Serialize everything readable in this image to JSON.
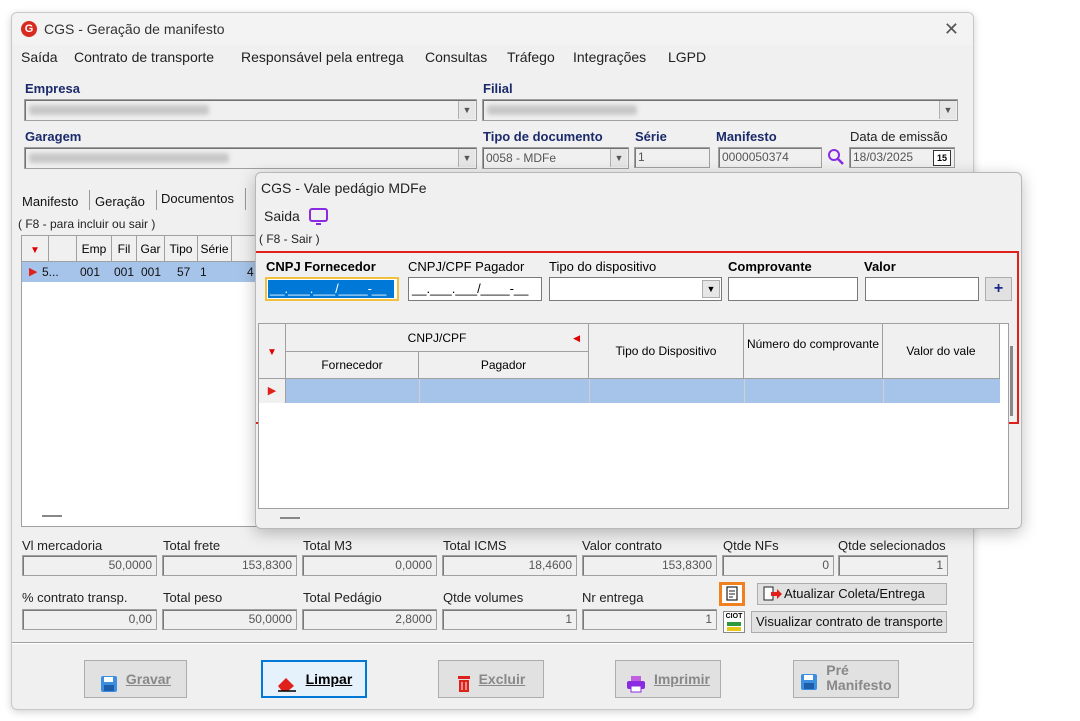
{
  "window": {
    "title": "CGS - Geração de manifesto",
    "logo_letter": "G"
  },
  "menu": [
    "Saída",
    "Contrato de transporte",
    "Responsável pela entrega",
    "Consultas",
    "Tráfego",
    "Integrações",
    "LGPD"
  ],
  "header": {
    "empresa_label": "Empresa",
    "filial_label": "Filial",
    "garagem_label": "Garagem",
    "tipo_documento_label": "Tipo de documento",
    "tipo_documento_value": "0058 - MDFe",
    "serie_label": "Série",
    "serie_value": "1",
    "manifesto_label": "Manifesto",
    "manifesto_value": "0000050374",
    "data_emissao_label": "Data de emissão",
    "data_emissao_value": "18/03/2025",
    "calendar_label": "15"
  },
  "tabs": [
    "Manifesto",
    "Geração",
    "Documentos"
  ],
  "tab_hint": "( F8 - para incluir ou sair )",
  "doc_grid": {
    "columns": [
      "Emp",
      "Fil",
      "Gar",
      "Tipo",
      "Série"
    ],
    "row": [
      "5...",
      "001",
      "001",
      "001",
      "57",
      "1",
      "4"
    ]
  },
  "totals": {
    "vl_mercadoria": {
      "label": "Vl mercadoria",
      "value": "50,0000"
    },
    "total_frete": {
      "label": "Total frete",
      "value": "153,8300"
    },
    "total_m3": {
      "label": "Total M3",
      "value": "0,0000"
    },
    "total_icms": {
      "label": "Total ICMS",
      "value": "18,4600"
    },
    "valor_contrato": {
      "label": "Valor contrato",
      "value": "153,8300"
    },
    "qtde_nfs": {
      "label": "Qtde NFs",
      "value": "0"
    },
    "qtde_selecionados": {
      "label": "Qtde selecionados",
      "value": "1"
    },
    "pct_contrato": {
      "label": "% contrato transp.",
      "value": "0,00"
    },
    "total_peso": {
      "label": "Total peso",
      "value": "50,0000"
    },
    "total_pedagio": {
      "label": "Total Pedágio",
      "value": "2,8000"
    },
    "qtde_volumes": {
      "label": "Qtde volumes",
      "value": "1"
    },
    "nr_entrega": {
      "label": "Nr entrega",
      "value": "1"
    }
  },
  "side_buttons": {
    "atualizar": "Atualizar Coleta/Entrega",
    "visualizar": "Visualizar contrato de transporte",
    "ciot_label": "CIOT"
  },
  "buttons": {
    "gravar": "Gravar",
    "limpar": "Limpar",
    "excluir": "Excluir",
    "imprimir": "Imprimir",
    "pre_manifesto_1": "Pré",
    "pre_manifesto_2": "Manifesto"
  },
  "popup": {
    "title": "CGS - Vale pedágio MDFe",
    "saida_label": "Saida",
    "hint": "( F8 - Sair )",
    "cnpj_fornecedor_label": "CNPJ Fornecedor",
    "cnpj_fornecedor_mask": "__.___.___/____-__",
    "cnpj_pagador_label": "CNPJ/CPF Pagador",
    "cnpj_pagador_mask": "__.___.___/____-__",
    "tipo_dispositivo_label": "Tipo do dispositivo",
    "comprovante_label": "Comprovante",
    "valor_label": "Valor",
    "add_label": "+",
    "grid": {
      "group_header": "CNPJ/CPF",
      "fornecedor": "Fornecedor",
      "pagador": "Pagador",
      "tipo_dispositivo": "Tipo do Dispositivo",
      "numero_comprovante": "Número do comprovante",
      "valor_vale": "Valor do vale"
    }
  },
  "colors": {
    "accent_red": "#e0211b",
    "label_navy": "#1a2a6a",
    "selection_blue": "#a6c4e9",
    "highlight_orange": "#f08020",
    "purple": "#8a2be2"
  }
}
